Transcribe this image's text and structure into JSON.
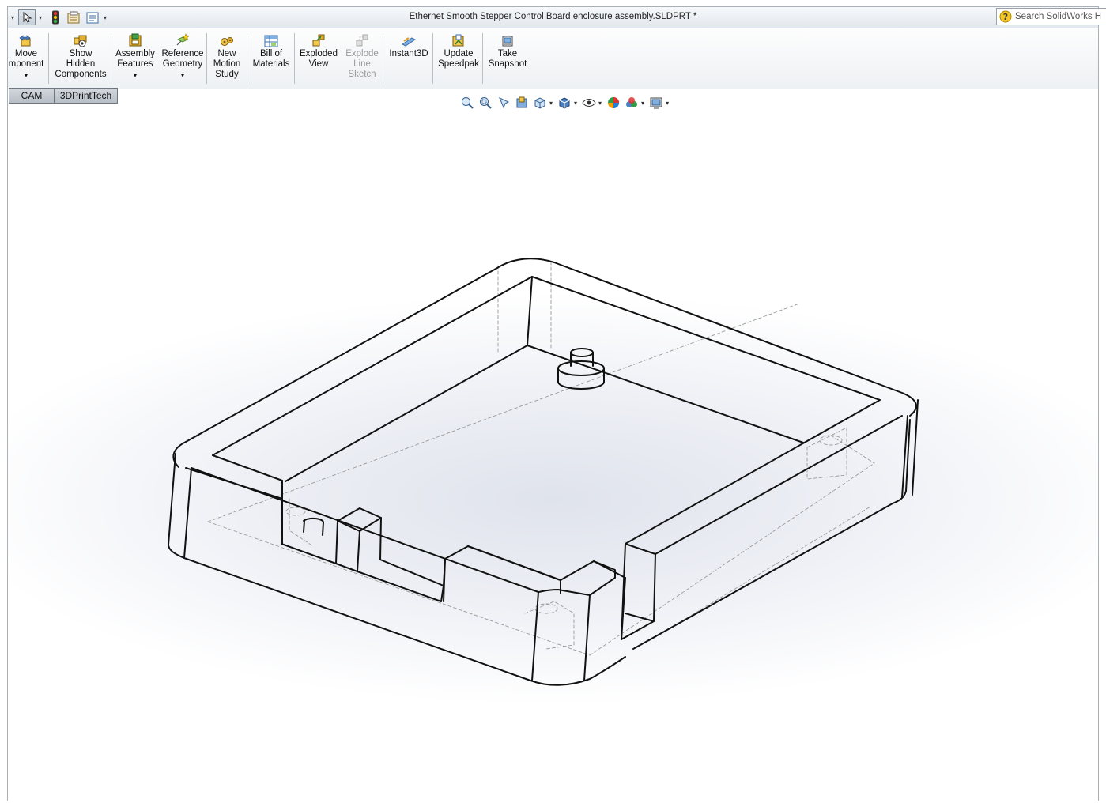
{
  "window": {
    "title": "Ethernet Smooth Stepper Control Board enclosure assembly.SLDPRT *",
    "search_placeholder": "Search SolidWorks H"
  },
  "quick_access": [
    {
      "icon": "dropdown-arrow-icon"
    },
    {
      "icon": "select-pointer-icon",
      "pressed": true
    },
    {
      "icon": "rebuild-traffic-light-icon"
    },
    {
      "icon": "file-properties-icon"
    },
    {
      "icon": "options-list-icon"
    }
  ],
  "ribbon": {
    "buttons": [
      {
        "id": "move-component",
        "label": "Move\nmponent",
        "icon": "move-component-icon",
        "dropdown": true,
        "enabled": true
      },
      {
        "id": "show-hidden-components",
        "label": "Show\nHidden\nComponents",
        "icon": "show-hidden-components-icon",
        "dropdown": false,
        "enabled": true
      },
      {
        "id": "assembly-features",
        "label": "Assembly\nFeatures",
        "icon": "assembly-features-icon",
        "dropdown": true,
        "enabled": true
      },
      {
        "id": "reference-geometry",
        "label": "Reference\nGeometry",
        "icon": "reference-geometry-icon",
        "dropdown": true,
        "enabled": true
      },
      {
        "id": "new-motion-study",
        "label": "New\nMotion\nStudy",
        "icon": "motion-study-icon",
        "dropdown": false,
        "enabled": true
      },
      {
        "id": "bill-of-materials",
        "label": "Bill of\nMaterials",
        "icon": "bill-of-materials-icon",
        "dropdown": false,
        "enabled": true
      },
      {
        "id": "exploded-view",
        "label": "Exploded\nView",
        "icon": "exploded-view-icon",
        "dropdown": false,
        "enabled": true
      },
      {
        "id": "explode-line-sketch",
        "label": "Explode\nLine\nSketch",
        "icon": "explode-line-sketch-icon",
        "dropdown": false,
        "enabled": false
      },
      {
        "id": "instant3d",
        "label": "Instant3D",
        "icon": "instant3d-icon",
        "dropdown": false,
        "enabled": true
      },
      {
        "id": "update-speedpak",
        "label": "Update\nSpeedpak",
        "icon": "speedpak-icon",
        "dropdown": false,
        "enabled": true
      },
      {
        "id": "take-snapshot",
        "label": "Take\nSnapshot",
        "icon": "snapshot-icon",
        "dropdown": false,
        "enabled": true
      }
    ]
  },
  "tabs": [
    {
      "label": "CAM"
    },
    {
      "label": "3DPrintTech"
    }
  ],
  "view_toolbar": [
    {
      "icon": "zoom-to-fit-icon"
    },
    {
      "icon": "zoom-to-area-icon"
    },
    {
      "icon": "previous-view-icon"
    },
    {
      "icon": "section-view-icon"
    },
    {
      "icon": "view-orientation-icon",
      "dropdown": true
    },
    {
      "icon": "display-style-icon",
      "dropdown": true
    },
    {
      "icon": "hide-show-items-icon",
      "dropdown": true
    },
    {
      "icon": "edit-appearance-icon"
    },
    {
      "icon": "apply-scene-icon",
      "dropdown": true
    },
    {
      "icon": "view-settings-icon",
      "dropdown": true
    }
  ],
  "colors": {
    "accent": "#4a7fc1",
    "model_edge": "#111111",
    "hidden_edge": "#9a9a9a"
  }
}
